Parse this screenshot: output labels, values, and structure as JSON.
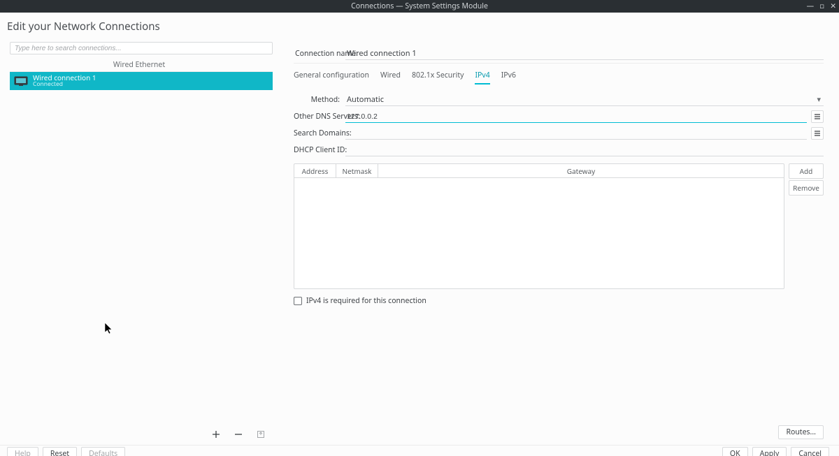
{
  "window": {
    "title": "Connections — System Settings Module"
  },
  "heading": "Edit your Network Connections",
  "search": {
    "placeholder": "Type here to search connections..."
  },
  "left": {
    "group_label": "Wired Ethernet",
    "connections": [
      {
        "name": "Wired connection 1",
        "status": "Connected"
      }
    ]
  },
  "right": {
    "connection_name_label": "Connection name:",
    "connection_name_value": "Wired connection 1",
    "tabs": {
      "general": "General configuration",
      "wired": "Wired",
      "sec": "802.1x Security",
      "ipv4": "IPv4",
      "ipv6": "IPv6"
    },
    "form": {
      "method_label": "Method:",
      "method_value": "Automatic",
      "other_dns_label": "Other DNS Servers:",
      "other_dns_value": "127.0.0.2",
      "search_domains_label": "Search Domains:",
      "search_domains_value": "",
      "dhcp_client_id_label": "DHCP Client ID:",
      "dhcp_client_id_value": ""
    },
    "addr_table": {
      "address": "Address",
      "netmask": "Netmask",
      "gateway": "Gateway",
      "add": "Add",
      "remove": "Remove"
    },
    "require_ipv4_label": "IPv4 is required for this connection",
    "routes_label": "Routes..."
  },
  "footer": {
    "help": "Help",
    "reset": "Reset",
    "defaults": "Defaults",
    "ok": "OK",
    "apply": "Apply",
    "cancel": "Cancel"
  }
}
